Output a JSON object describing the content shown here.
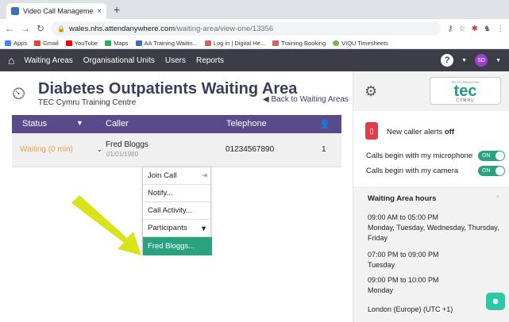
{
  "browser": {
    "tab_title": "Video Call Management",
    "tab_close": "×",
    "new_tab": "+",
    "url_host": "wales.nhs.attendanywhere.com",
    "url_path": "/waiting-area/view-one/13356",
    "bookmarks": [
      "Apps",
      "Gmail",
      "YouTube",
      "Maps",
      "AA Training Waitin...",
      "Log in | Digital He...",
      "Training Booking",
      "VIQU Timesheets"
    ]
  },
  "nav": {
    "links": [
      "Waiting Areas",
      "Organisational Units",
      "Users",
      "Reports"
    ],
    "help": "?",
    "avatar_initials": "SD"
  },
  "page": {
    "title": "Diabetes Outpatients Waiting Area",
    "subtitle": "TEC Cymru Training Centre",
    "back_link": "Back to Waiting Areas"
  },
  "table": {
    "headers": {
      "status": "Status",
      "caller": "Caller",
      "telephone": "Telephone"
    },
    "row": {
      "status": "Waiting (0 min)",
      "caller_name": "Fred Bloggs",
      "caller_dob": "01/01/1980",
      "telephone": "01234567890",
      "participants_count": "1"
    }
  },
  "menu": {
    "items": [
      "Join Call",
      "Notify...",
      "Call Activity...",
      "Participants",
      "Fred Bloggs..."
    ]
  },
  "panel": {
    "logo_top": "TELECONSULTING",
    "logo_main": "tec",
    "logo_bottom": "CYMRU",
    "alert_label": "New caller alerts",
    "alert_state": "off",
    "mic_label": "Calls begin with my microphone",
    "cam_label": "Calls begin with my camera",
    "toggle_on": "ON",
    "hours_title": "Waiting Area hours",
    "schedule": [
      {
        "time": "09:00 AM to 05:00 PM",
        "days": "Monday, Tuesday, Wednesday, Thursday, Friday"
      },
      {
        "time": "07:00 PM to 09:00 PM",
        "days": "Tuesday"
      },
      {
        "time": "09:00 PM to 10:00 PM",
        "days": "Monday"
      }
    ],
    "timezone": "London (Europe) (UTC +1)"
  },
  "colors": {
    "navbar": "#3d3d47",
    "table_header": "#5b4a8a",
    "accent_green": "#2aa17f",
    "arrow": "#d8e31a",
    "waiting": "#f0a050",
    "alert_red": "#e03c4b"
  }
}
